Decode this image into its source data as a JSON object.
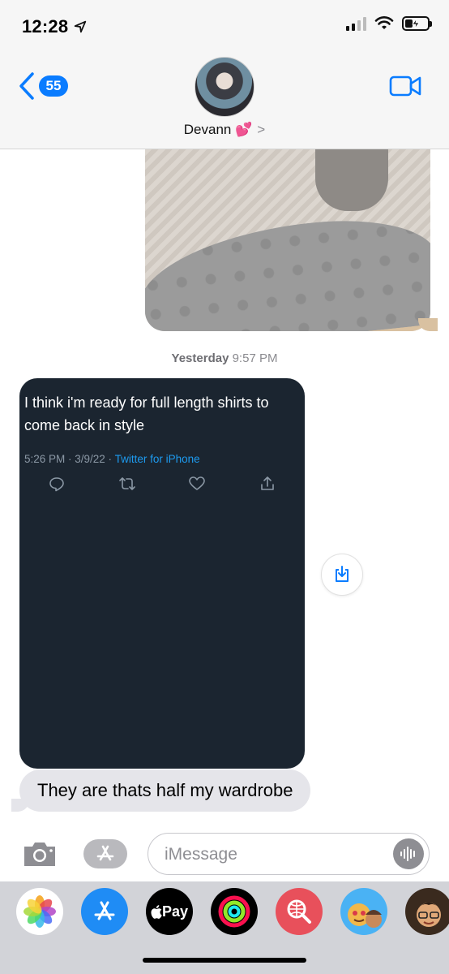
{
  "status_bar": {
    "time": "12:28"
  },
  "header": {
    "back_count": "55",
    "contact_name": "Devann 💕",
    "chevron": ">"
  },
  "conversation": {
    "timestamp_day": "Yesterday",
    "timestamp_time": "9:57 PM",
    "tweet": {
      "text": "I think i'm ready for full length shirts to come back in style",
      "meta": "5:26 PM · 3/9/22 · ",
      "source": "Twitter for iPhone"
    },
    "message": "They are thats half my wardrobe"
  },
  "input": {
    "placeholder": "iMessage"
  },
  "app_drawer": {
    "pay_label": "Pay",
    "apps": [
      "photos-icon",
      "app-store-icon",
      "apple-pay-icon",
      "fitness-icon",
      "image-search-icon",
      "memoji-icon",
      "memoji-icon"
    ]
  },
  "colors": {
    "accent": "#0a7cff",
    "tweet_bg": "#1b2530",
    "received_bubble": "#e5e5ea",
    "tweet_link": "#1d9bf0"
  }
}
